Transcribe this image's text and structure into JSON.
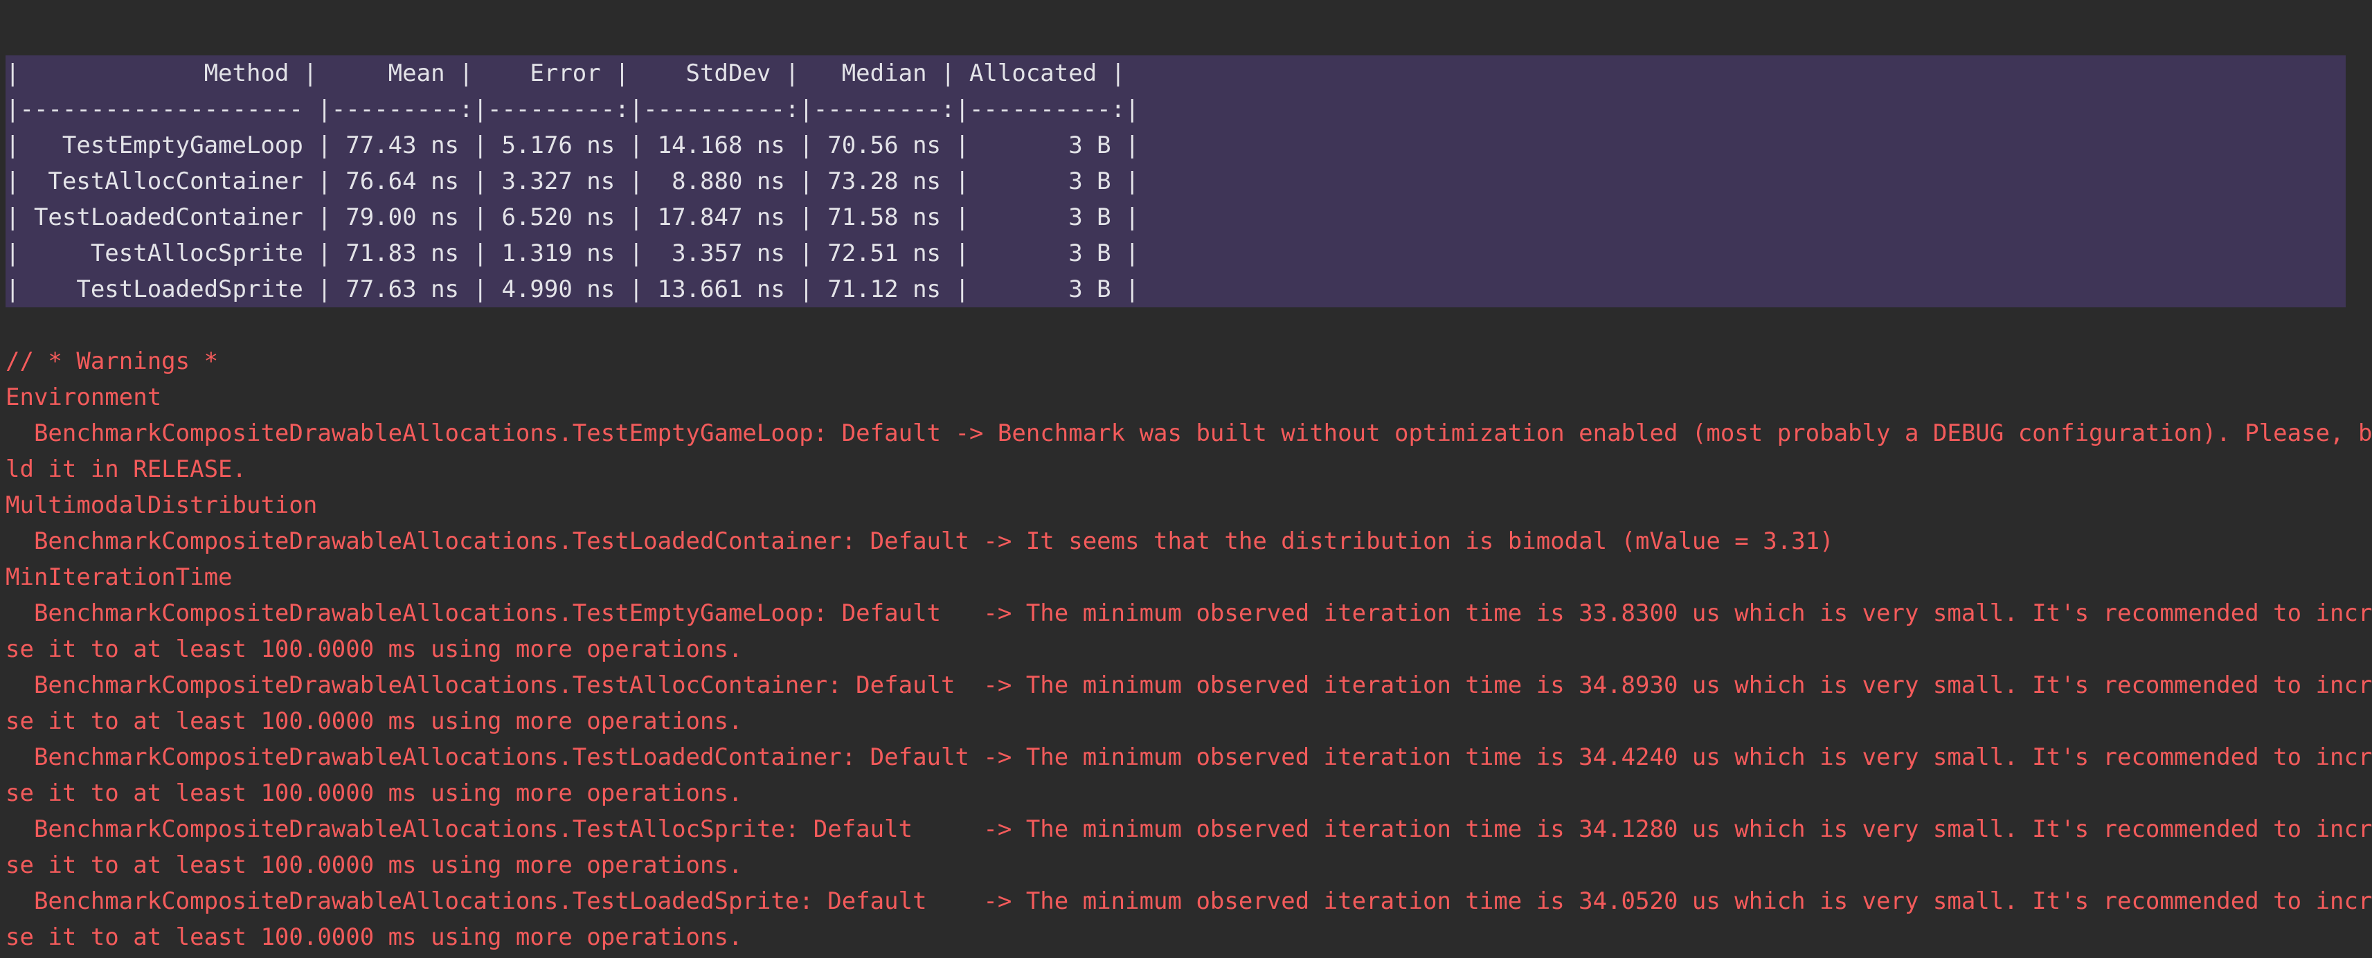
{
  "table": {
    "header": "|             Method |     Mean |    Error |    StdDev |   Median | Allocated |",
    "separator": "|-------------------- |---------:|---------:|----------:|---------:|----------:|",
    "rows": [
      "|   TestEmptyGameLoop | 77.43 ns | 5.176 ns | 14.168 ns | 70.56 ns |       3 B |",
      "|  TestAllocContainer | 76.64 ns | 3.327 ns |  8.880 ns | 73.28 ns |       3 B |",
      "| TestLoadedContainer | 79.00 ns | 6.520 ns | 17.847 ns | 71.58 ns |       3 B |",
      "|     TestAllocSprite | 71.83 ns | 1.319 ns |  3.357 ns | 72.51 ns |       3 B |",
      "|    TestLoadedSprite | 77.63 ns | 4.990 ns | 13.661 ns | 71.12 ns |       3 B |"
    ]
  },
  "warnings": {
    "lines": [
      "// * Warnings *",
      "Environment",
      "  BenchmarkCompositeDrawableAllocations.TestEmptyGameLoop: Default -> Benchmark was built without optimization enabled (most probably a DEBUG configuration). Please, bui",
      "ld it in RELEASE.",
      "MultimodalDistribution",
      "  BenchmarkCompositeDrawableAllocations.TestLoadedContainer: Default -> It seems that the distribution is bimodal (mValue = 3.31)",
      "MinIterationTime",
      "  BenchmarkCompositeDrawableAllocations.TestEmptyGameLoop: Default   -> The minimum observed iteration time is 33.8300 us which is very small. It's recommended to increa",
      "se it to at least 100.0000 ms using more operations.",
      "  BenchmarkCompositeDrawableAllocations.TestAllocContainer: Default  -> The minimum observed iteration time is 34.8930 us which is very small. It's recommended to increa",
      "se it to at least 100.0000 ms using more operations.",
      "  BenchmarkCompositeDrawableAllocations.TestLoadedContainer: Default -> The minimum observed iteration time is 34.4240 us which is very small. It's recommended to increa",
      "se it to at least 100.0000 ms using more operations.",
      "  BenchmarkCompositeDrawableAllocations.TestAllocSprite: Default     -> The minimum observed iteration time is 34.1280 us which is very small. It's recommended to increa",
      "se it to at least 100.0000 ms using more operations.",
      "  BenchmarkCompositeDrawableAllocations.TestLoadedSprite: Default    -> The minimum observed iteration time is 34.0520 us which is very small. It's recommended to increa",
      "se it to at least 100.0000 ms using more operations."
    ]
  },
  "colors": {
    "background": "#2b2b2b",
    "selection": "#3f3557",
    "table_text": "#e3e3e8",
    "warning_text": "#f35b5b"
  }
}
